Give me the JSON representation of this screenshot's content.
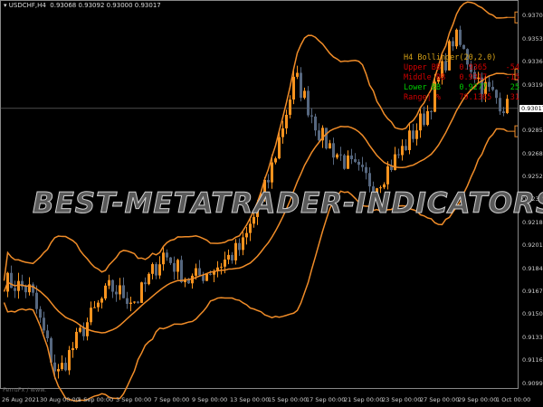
{
  "header": {
    "symbol": "USDCHF,H4",
    "ohlc": "0.93068 0.93092 0.93000 0.93017"
  },
  "price_axis": {
    "labels": [
      "0.93700",
      "0.93530",
      "0.93360",
      "0.93190",
      "0.92855",
      "0.92685",
      "0.92520",
      "0.92350",
      "0.92180",
      "0.92010",
      "0.91840",
      "0.91675",
      "0.91505",
      "0.91335",
      "0.91165",
      "0.90995"
    ],
    "current": "0.93017"
  },
  "time_axis": [
    "26 Aug 2021",
    "30 Aug 00:00",
    "1 Sep 00:00",
    "3 Sep 00:00",
    "7 Sep 00:00",
    "9 Sep 00:00",
    "13 Sep 00:00",
    "15 Sep 00:00",
    "17 Sep 00:00",
    "21 Sep 00:00",
    "23 Sep 00:00",
    "27 Sep 00:00",
    "29 Sep 00:00",
    "1 Oct 00:00"
  ],
  "panel": {
    "title": "H4 Bollinger(20,2.0)",
    "rows": [
      {
        "label": "Upper BB",
        "value": "0.9365",
        "change": "-54",
        "color": "#d00000"
      },
      {
        "label": "Middle BB",
        "value": "0.9317",
        "change": "-15",
        "color": "#d00000"
      },
      {
        "label": "Lower BB",
        "value": "0.9277",
        "change": "25",
        "color": "#00cc00"
      },
      {
        "label": "Range| %",
        "value": "79.1365",
        "change": "31",
        "color": "#d00000"
      }
    ]
  },
  "watermark": "BEST-METATRADER-INDICATORS.COM",
  "credit": "FerruFx / www.",
  "colors": {
    "bull": "#f7931e",
    "bear": "#56677f",
    "band": "#f08c28",
    "title": "#d4a017"
  },
  "price_path": [
    0.9175,
    0.9168,
    0.9105,
    0.914,
    0.917,
    0.916,
    0.9195,
    0.9175,
    0.9185,
    0.92,
    0.925,
    0.9325,
    0.928,
    0.926,
    0.9245,
    0.927,
    0.93,
    0.9355,
    0.932,
    0.9302
  ]
}
